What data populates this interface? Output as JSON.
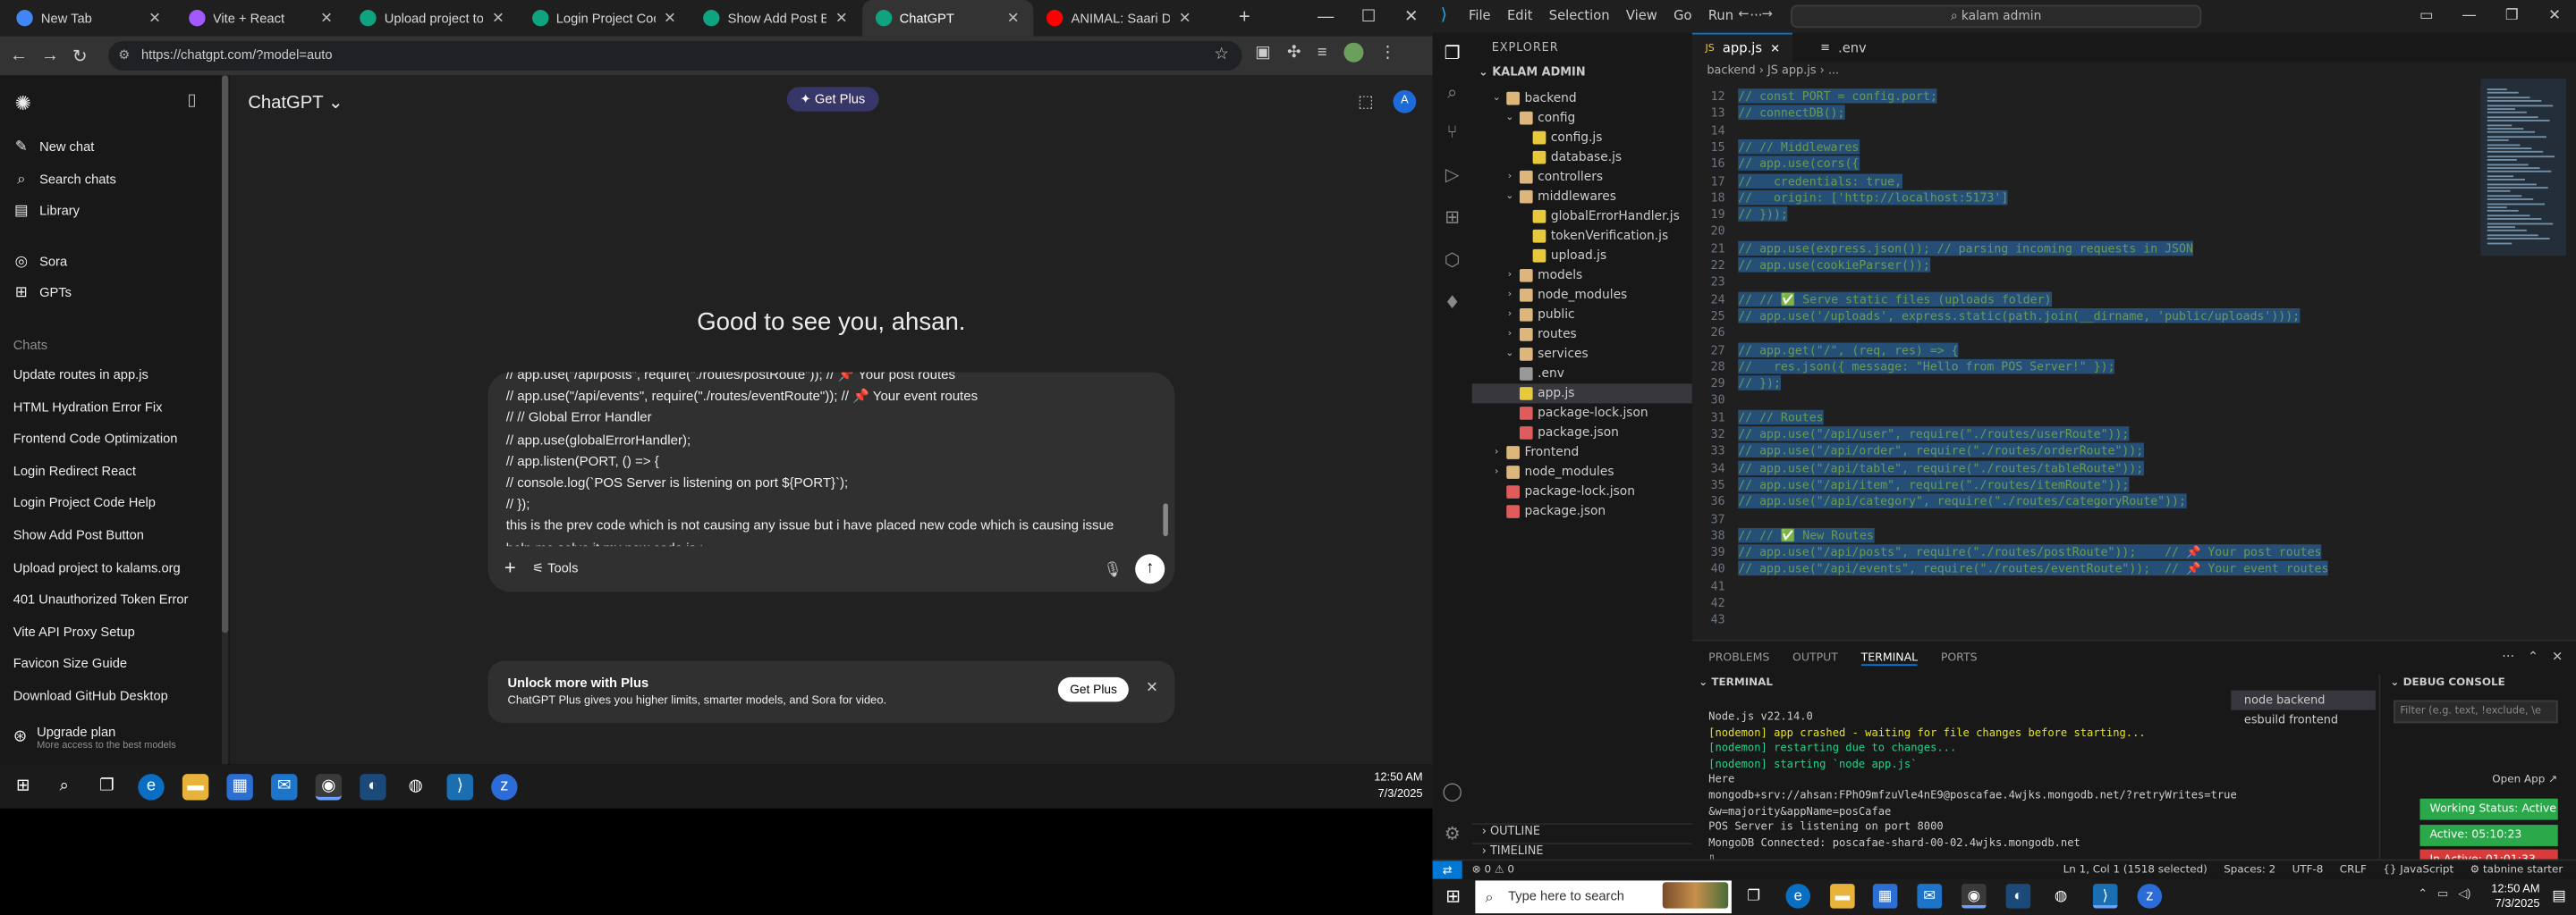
{
  "chrome": {
    "tabs": [
      {
        "label": "New Tab",
        "icon": "chrome-icon",
        "color": "#4285f4"
      },
      {
        "label": "Vite + React",
        "icon": "vite-icon",
        "color": "#a259ff"
      },
      {
        "label": "Upload project to kala",
        "icon": "chatgpt-icon",
        "color": "#10a37f"
      },
      {
        "label": "Login Project Code He",
        "icon": "chatgpt-icon",
        "color": "#10a37f"
      },
      {
        "label": "Show Add Post Button",
        "icon": "chatgpt-icon",
        "color": "#10a37f"
      },
      {
        "label": "ChatGPT",
        "icon": "chatgpt-icon",
        "color": "#10a37f"
      },
      {
        "label": "ANIMAL: Saari Du",
        "icon": "youtube-icon",
        "color": "#ff0000"
      }
    ],
    "url": "https://chatgpt.com/?model=auto"
  },
  "chatgpt": {
    "title": "ChatGPT",
    "get_plus": "Get Plus",
    "avatar_letter": "A",
    "greeting": "Good to see you, ahsan.",
    "nav": [
      {
        "label": "New chat",
        "icon": "✎"
      },
      {
        "label": "Search chats",
        "icon": "⌕"
      },
      {
        "label": "Library",
        "icon": "▤"
      },
      {
        "label": "Sora",
        "icon": "◎"
      },
      {
        "label": "GPTs",
        "icon": "⊞"
      }
    ],
    "chats_heading": "Chats",
    "chats": [
      "Update routes in app.js",
      "HTML Hydration Error Fix",
      "Frontend Code Optimization",
      "Login Redirect React",
      "Login Project Code Help",
      "Show Add Post Button",
      "Upload project to kalams.org",
      "401 Unauthorized Token Error",
      "Vite API Proxy Setup",
      "Favicon Size Guide",
      "Download GitHub Desktop"
    ],
    "upgrade_title": "Upgrade plan",
    "upgrade_sub": "More access to the best models",
    "composer_lines": [
      "// app.use(\"/api/posts\", require(\"./routes/postRoute\"));   // 📌 Your post routes",
      "// app.use(\"/api/events\", require(\"./routes/eventRoute\"));   // 📌 Your event routes",
      "// // Global Error Handler",
      "// app.use(globalErrorHandler);",
      "// app.listen(PORT, () => {",
      "//    console.log(`POS Server is listening on port ${PORT}`);",
      "// });",
      "this is the prev code which is not causing any issue but i have placed new code which is causing issue",
      "help me solve it my new code is :"
    ],
    "tools_label": "Tools",
    "plus_card_title": "Unlock more with Plus",
    "plus_card_desc": "ChatGPT Plus gives you higher limits, smarter models, and Sora for video.",
    "plus_card_btn": "Get Plus"
  },
  "taskbar_left": {
    "time": "12:50 AM",
    "date": "7/3/2025"
  },
  "vscode": {
    "menu": [
      "File",
      "Edit",
      "Selection",
      "View",
      "Go",
      "Run",
      "···"
    ],
    "search": "kalam admin",
    "explorer_title": "EXPLORER",
    "project": "KALAM ADMIN",
    "tree": [
      {
        "label": "backend",
        "depth": 1,
        "type": "folder-open"
      },
      {
        "label": "config",
        "depth": 2,
        "type": "folder-open"
      },
      {
        "label": "config.js",
        "depth": 3,
        "type": "js"
      },
      {
        "label": "database.js",
        "depth": 3,
        "type": "js"
      },
      {
        "label": "controllers",
        "depth": 2,
        "type": "folder"
      },
      {
        "label": "middlewares",
        "depth": 2,
        "type": "folder-open"
      },
      {
        "label": "globalErrorHandler.js",
        "depth": 3,
        "type": "js"
      },
      {
        "label": "tokenVerification.js",
        "depth": 3,
        "type": "js"
      },
      {
        "label": "upload.js",
        "depth": 3,
        "type": "js"
      },
      {
        "label": "models",
        "depth": 2,
        "type": "folder"
      },
      {
        "label": "node_modules",
        "depth": 2,
        "type": "folder"
      },
      {
        "label": "public",
        "depth": 2,
        "type": "folder"
      },
      {
        "label": "routes",
        "depth": 2,
        "type": "folder"
      },
      {
        "label": "services",
        "depth": 2,
        "type": "folder-open"
      },
      {
        "label": ".env",
        "depth": 2,
        "type": "env"
      },
      {
        "label": "app.js",
        "depth": 2,
        "type": "js",
        "selected": true
      },
      {
        "label": "package-lock.json",
        "depth": 2,
        "type": "json"
      },
      {
        "label": "package.json",
        "depth": 2,
        "type": "json"
      },
      {
        "label": "Frontend",
        "depth": 1,
        "type": "folder"
      },
      {
        "label": "node_modules",
        "depth": 1,
        "type": "folder"
      },
      {
        "label": "package-lock.json",
        "depth": 1,
        "type": "json"
      },
      {
        "label": "package.json",
        "depth": 1,
        "type": "json"
      }
    ],
    "outline": "OUTLINE",
    "timeline": "TIMELINE",
    "editor_tabs": [
      "app.js",
      ".env"
    ],
    "breadcrumb": "backend › JS app.js › ...",
    "code": [
      {
        "n": 12,
        "t": "// const PORT = config.port;"
      },
      {
        "n": 13,
        "t": "// connectDB();"
      },
      {
        "n": 14,
        "t": ""
      },
      {
        "n": 15,
        "t": "// // Middlewares"
      },
      {
        "n": 16,
        "t": "// app.use(cors({"
      },
      {
        "n": 17,
        "t": "//   credentials: true,"
      },
      {
        "n": 18,
        "t": "//   origin: ['http://localhost:5173']"
      },
      {
        "n": 19,
        "t": "// }));"
      },
      {
        "n": 20,
        "t": ""
      },
      {
        "n": 21,
        "t": "// app.use(express.json()); // parsing incoming requests in JSON"
      },
      {
        "n": 22,
        "t": "// app.use(cookieParser());"
      },
      {
        "n": 23,
        "t": ""
      },
      {
        "n": 24,
        "t": "// // ✅ Serve static files (uploads folder)"
      },
      {
        "n": 25,
        "t": "// app.use('/uploads', express.static(path.join(__dirname, 'public/uploads')));"
      },
      {
        "n": 26,
        "t": ""
      },
      {
        "n": 27,
        "t": "// app.get(\"/\", (req, res) => {"
      },
      {
        "n": 28,
        "t": "//   res.json({ message: \"Hello from POS Server!\" });"
      },
      {
        "n": 29,
        "t": "// });"
      },
      {
        "n": 30,
        "t": ""
      },
      {
        "n": 31,
        "t": "// // Routes"
      },
      {
        "n": 32,
        "t": "// app.use(\"/api/user\", require(\"./routes/userRoute\"));"
      },
      {
        "n": 33,
        "t": "// app.use(\"/api/order\", require(\"./routes/orderRoute\"));"
      },
      {
        "n": 34,
        "t": "// app.use(\"/api/table\", require(\"./routes/tableRoute\"));"
      },
      {
        "n": 35,
        "t": "// app.use(\"/api/item\", require(\"./routes/itemRoute\"));"
      },
      {
        "n": 36,
        "t": "// app.use(\"/api/category\", require(\"./routes/categoryRoute\"));"
      },
      {
        "n": 37,
        "t": ""
      },
      {
        "n": 38,
        "t": "// // ✅ New Routes"
      },
      {
        "n": 39,
        "t": "// app.use(\"/api/posts\", require(\"./routes/postRoute\"));    // 📌 Your post routes"
      },
      {
        "n": 40,
        "t": "// app.use(\"/api/events\", require(\"./routes/eventRoute\"));  // 📌 Your event routes"
      },
      {
        "n": 41,
        "t": ""
      },
      {
        "n": 42,
        "t": ""
      },
      {
        "n": 43,
        "t": ""
      }
    ],
    "panel_tabs": [
      "PROBLEMS",
      "OUTPUT",
      "TERMINAL",
      "PORTS"
    ],
    "terminal_heading": "TERMINAL",
    "terminal": [
      {
        "t": "Node.js v22.14.0",
        "c": ""
      },
      {
        "t": "[nodemon] app crashed - waiting for file changes before starting...",
        "c": "y"
      },
      {
        "t": "[nodemon] restarting due to changes...",
        "c": "g"
      },
      {
        "t": "[nodemon] starting `node app.js`",
        "c": "g"
      },
      {
        "t": "Here",
        "c": ""
      },
      {
        "t": "mongodb+srv://ahsan:FPhO9mfzuVle4nE9@poscafae.4wjks.mongodb.net/?retryWrites=true",
        "c": ""
      },
      {
        "t": "&w=majority&appName=posCafae",
        "c": ""
      },
      {
        "t": "POS Server is listening on port 8000",
        "c": ""
      },
      {
        "t": "MongoDB Connected: poscafae-shard-00-02.4wjks.mongodb.net",
        "c": ""
      },
      {
        "t": "▯",
        "c": ""
      }
    ],
    "terminal_sessions": [
      "node  backend",
      "esbuild  frontend"
    ],
    "debug_heading": "DEBUG CONSOLE",
    "debug_filter": "Filter (e.g. text, !exclude, \\e",
    "open_app": "Open App ↗",
    "pills": [
      {
        "label": "Working Status: Active",
        "color": "#2aa84a"
      },
      {
        "label": "Active: 05:10:23",
        "color": "#2aa84a"
      },
      {
        "label": "In Active: 01:01:33",
        "color": "#d93a3a"
      }
    ],
    "status_left": "⊗ 0 ⚠ 0",
    "status_right": [
      "Ln 1, Col 1 (1518 selected)",
      "Spaces: 2",
      "UTF-8",
      "CRLF",
      "{} JavaScript",
      "⚙ tabnine starter"
    ]
  },
  "taskbar_right": {
    "search_placeholder": "Type here to search",
    "time": "12:50 AM",
    "date": "7/3/2025"
  }
}
